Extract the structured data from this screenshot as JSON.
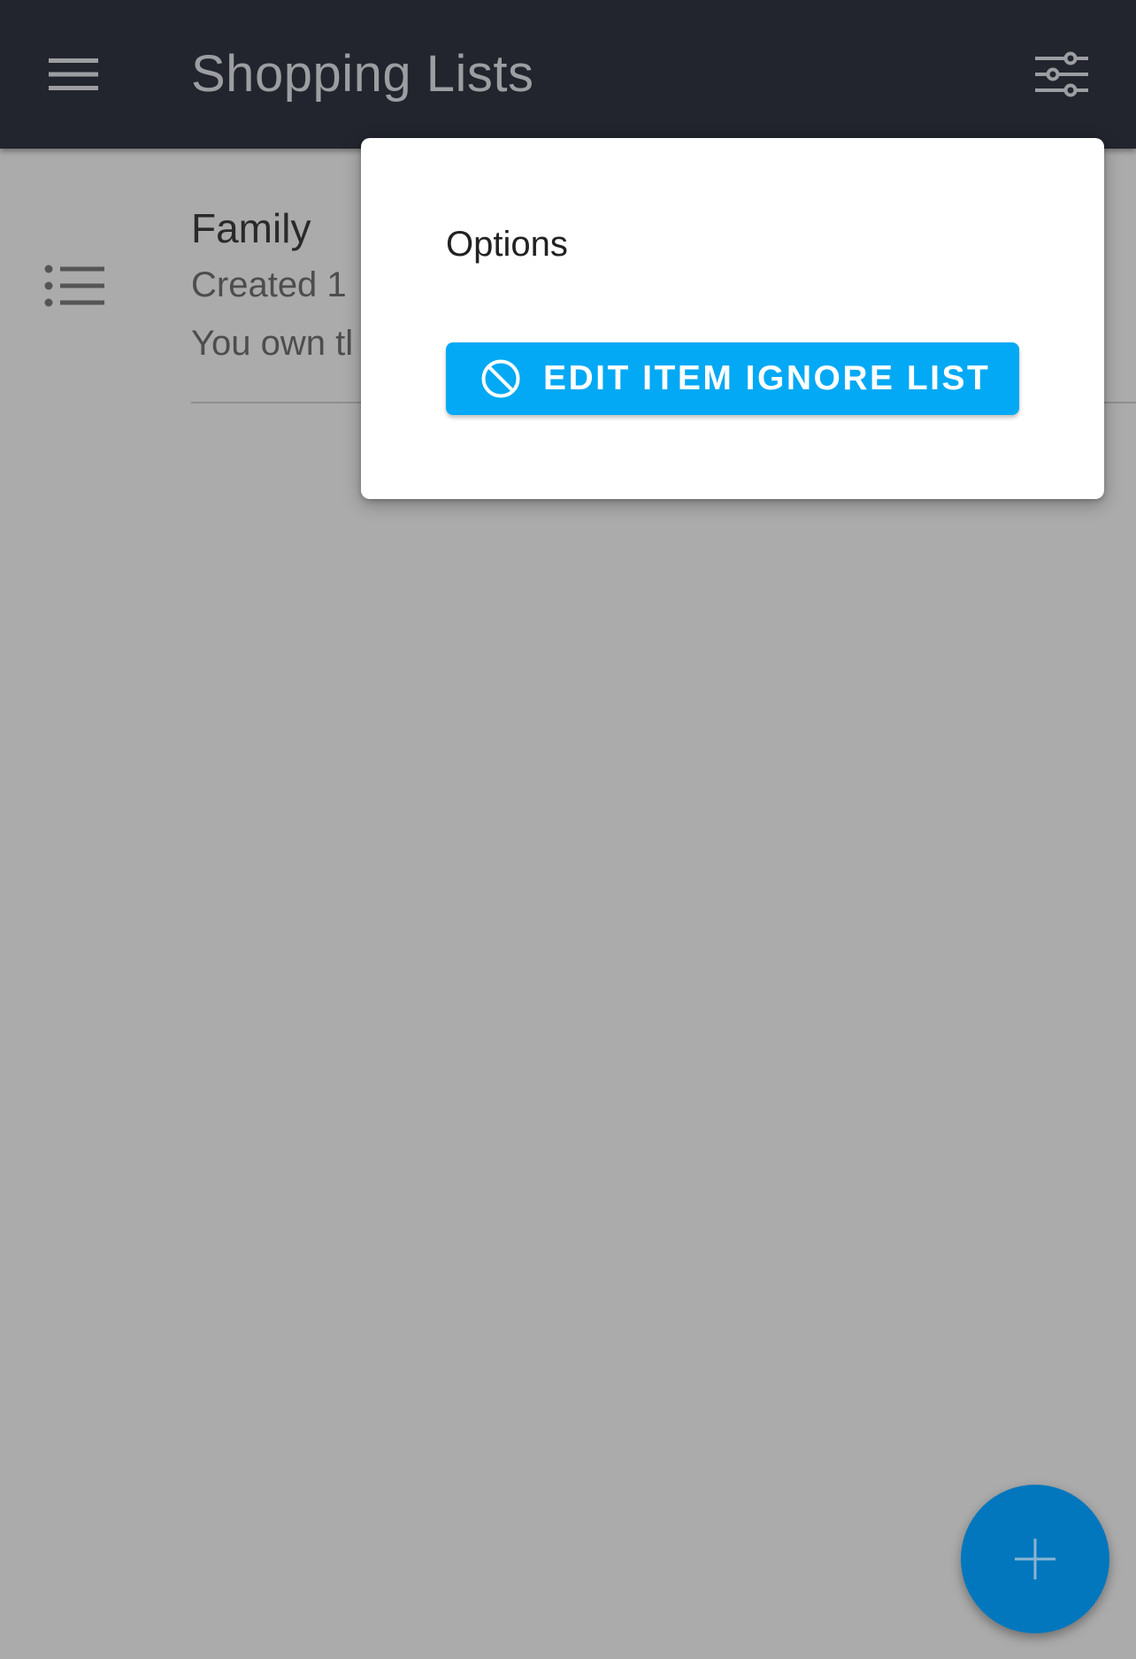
{
  "app_bar": {
    "title": "Shopping Lists",
    "menu_icon": "hamburger-menu-icon",
    "filter_icon": "sliders-options-icon",
    "background_color": "#22252d"
  },
  "lists": [
    {
      "name": "Family",
      "created_text": "Created 1",
      "owner_text": "You own tl",
      "icon": "list-icon"
    }
  ],
  "options_popup": {
    "title": "Options",
    "ignore_button_label": "EDIT ITEM IGNORE LIST",
    "ignore_button_icon": "block-icon",
    "button_color": "#03a9f4"
  },
  "fab": {
    "icon": "plus-icon",
    "color": "#0277bd"
  },
  "overlay_color": "#ababab"
}
